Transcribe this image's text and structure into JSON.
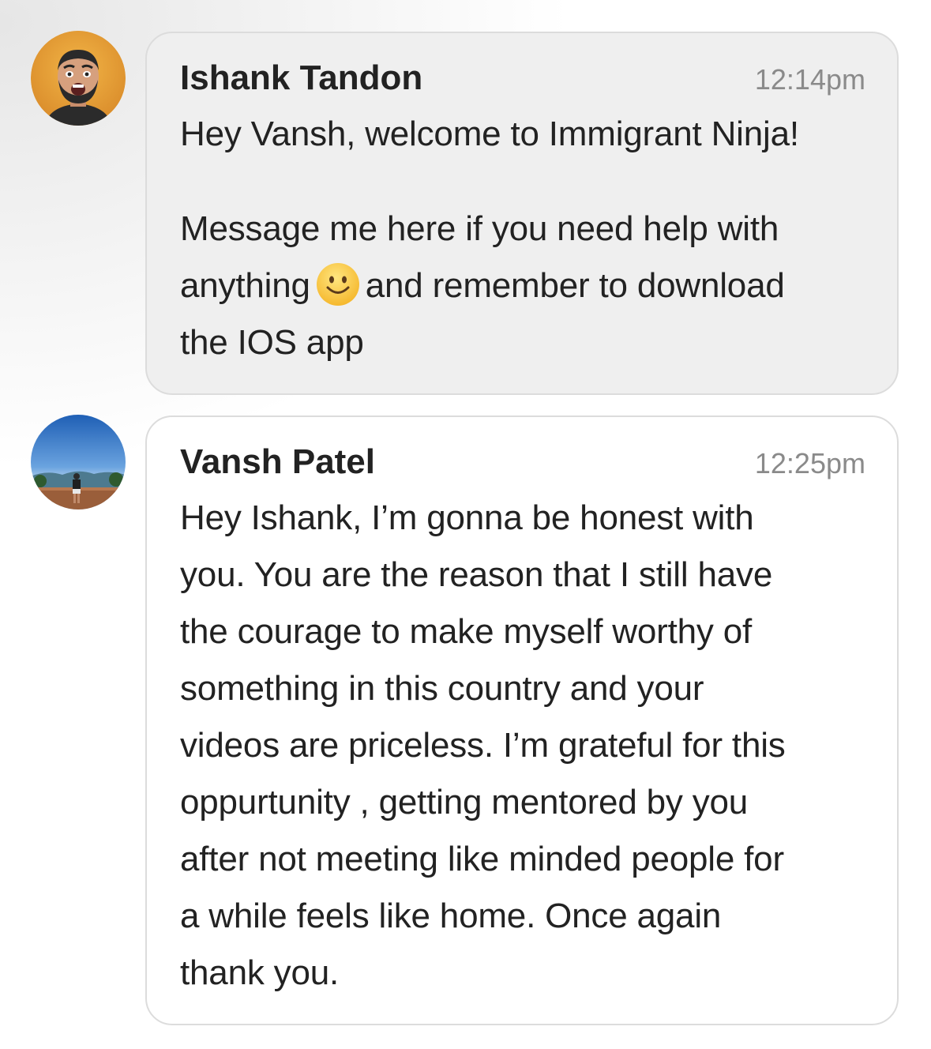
{
  "messages": [
    {
      "sender": "Ishank Tandon",
      "time": "12:14pm",
      "paragraph1": "Hey Vansh, welcome to Immigrant Ninja!",
      "paragraph2_line1": "Message me here if you need help with",
      "paragraph2_line2_before": "anything",
      "emoji": "slightly-smiling-face-icon",
      "paragraph2_line2_after": "and remember to download",
      "paragraph2_line3": "the IOS app",
      "avatar_bg": "#e8a33b"
    },
    {
      "sender": "Vansh Patel",
      "time": "12:25pm",
      "lines": [
        "Hey Ishank, I’m gonna be honest with",
        "you. You are the reason that I still have",
        "the courage to make myself worthy of",
        "something in this country and your",
        "videos are priceless. I’m grateful for this",
        "oppurtunity , getting mentored by you",
        "after not meeting like minded people for",
        "a while feels like home. Once again",
        "thank you."
      ],
      "avatar_bg": "#2f6fb8"
    }
  ]
}
